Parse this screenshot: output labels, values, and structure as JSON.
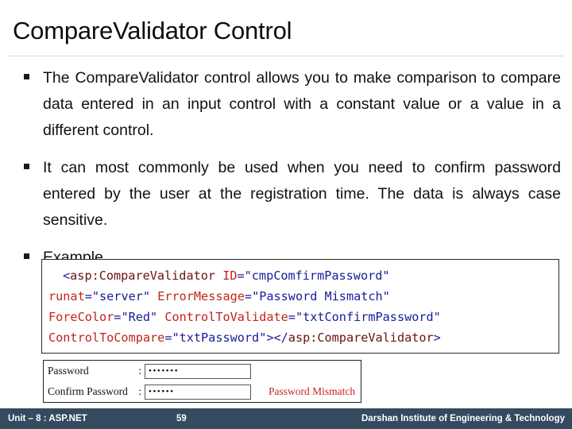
{
  "slide": {
    "title": "CompareValidator Control"
  },
  "bullets": [
    {
      "marker": "square-bullet",
      "text": "The CompareValidator control allows you to make comparison to compare data entered in an input control with a constant value or a value in a different control."
    },
    {
      "marker": "square-bullet",
      "text": "It can most commonly be used when you need to confirm password entered by the user at the registration time. The data is always case sensitive."
    },
    {
      "marker": "square-bullet",
      "text": "Example"
    }
  ],
  "code": {
    "language": "aspx",
    "lines": [
      [
        {
          "t": "punct",
          "s": "<"
        },
        {
          "t": "tag",
          "s": "asp:CompareValidator"
        },
        {
          "t": "plain",
          "s": " "
        },
        {
          "t": "attr",
          "s": "ID"
        },
        {
          "t": "eq",
          "s": "="
        },
        {
          "t": "val",
          "s": "\"cmpComfirmPassword\""
        }
      ],
      [
        {
          "t": "attr",
          "s": "runat"
        },
        {
          "t": "eq",
          "s": "="
        },
        {
          "t": "val",
          "s": "\"server\""
        },
        {
          "t": "plain",
          "s": " "
        },
        {
          "t": "attr",
          "s": "ErrorMessage"
        },
        {
          "t": "eq",
          "s": "="
        },
        {
          "t": "val",
          "s": "\"Password Mismatch\""
        }
      ],
      [
        {
          "t": "attr",
          "s": "ForeColor"
        },
        {
          "t": "eq",
          "s": "="
        },
        {
          "t": "val",
          "s": "\"Red\""
        },
        {
          "t": "plain",
          "s": " "
        },
        {
          "t": "attr",
          "s": "ControlToValidate"
        },
        {
          "t": "eq",
          "s": "="
        },
        {
          "t": "val",
          "s": "\"txtConfirmPassword\""
        }
      ],
      [
        {
          "t": "attr",
          "s": "ControlToCompare"
        },
        {
          "t": "eq",
          "s": "="
        },
        {
          "t": "val",
          "s": "\"txtPassword\""
        },
        {
          "t": "punct",
          "s": ">"
        },
        {
          "t": "punct",
          "s": "</"
        },
        {
          "t": "tag",
          "s": "asp:CompareValidator"
        },
        {
          "t": "punct",
          "s": ">"
        }
      ]
    ]
  },
  "form_preview": {
    "rows": [
      {
        "label": "Password",
        "colon": ":",
        "value": "•••••••",
        "error": ""
      },
      {
        "label": "Confirm Password",
        "colon": ":",
        "value": "••••••",
        "error": "Password Mismatch"
      }
    ]
  },
  "footer": {
    "left": "Unit – 8 : ASP.NET",
    "page": "59",
    "right": "Darshan Institute of Engineering & Technology",
    "background": "#334a5f"
  },
  "colors": {
    "footer_bg": "#334a5f",
    "code_tag": "#6a1111",
    "code_attr": "#c0241c",
    "code_value": "#1a1a9c",
    "error_red": "#cc2222",
    "rule": "#d9d9d9"
  }
}
